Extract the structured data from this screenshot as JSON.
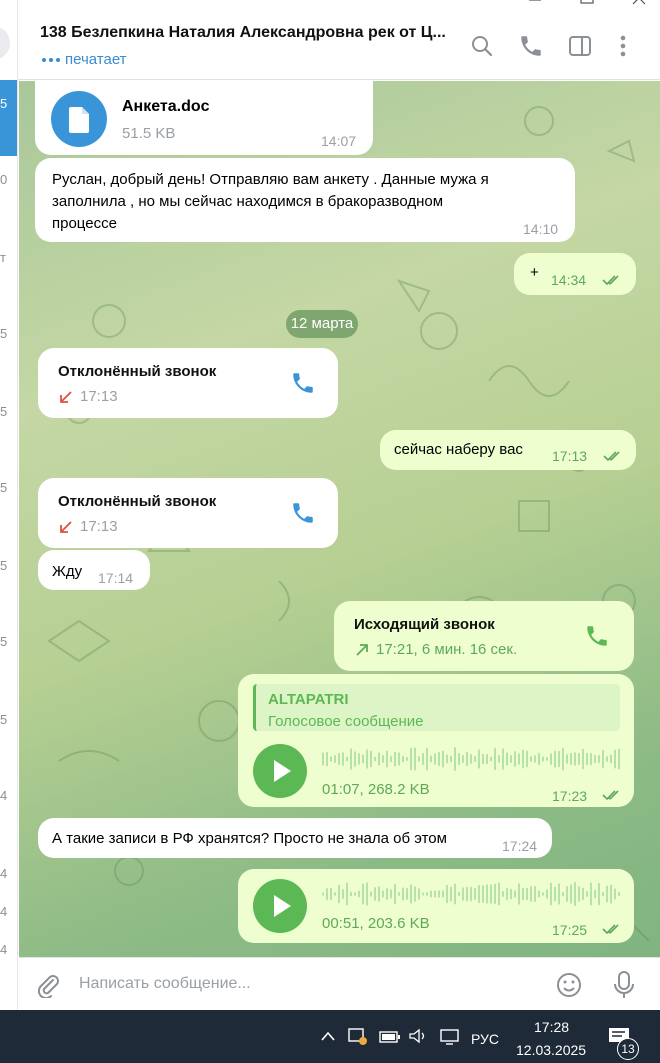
{
  "window": {
    "controls": [
      "minimize",
      "maximize",
      "close"
    ]
  },
  "chat_list_sliver": {
    "cut_texts": [
      "5",
      "0",
      "т",
      "5",
      "5",
      "5",
      "5",
      "5",
      "5",
      "4",
      "4",
      "4",
      "4"
    ]
  },
  "header": {
    "title": "138 Безлепкина Наталия Александровна рек от Ц...",
    "status": "печатает",
    "icons": [
      "search-icon",
      "phone-icon",
      "sidebar-toggle-icon",
      "more-vertical-icon"
    ]
  },
  "messages": {
    "file": {
      "name": "Анкета.doc",
      "size": "51.5 KB",
      "time": "14:07"
    },
    "m1": {
      "line1": "Руслан, добрый день! Отправляю вам анкету . Данные мужа я",
      "line2": "заполнила , но мы сейчас находимся в бракоразводном",
      "line3": "процессе",
      "time": "14:10"
    },
    "m2": {
      "text": "+",
      "time": "14:34"
    },
    "date_chip": "12 марта",
    "call1": {
      "title": "Отклонённый звонок",
      "time": "17:13"
    },
    "m3": {
      "text": "сейчас наберу вас",
      "time": "17:13"
    },
    "call2": {
      "title": "Отклонённый звонок",
      "time": "17:13"
    },
    "m4": {
      "text": "Жду",
      "time": "17:14"
    },
    "call3": {
      "title": "Исходящий звонок",
      "meta": "17:21, 6 мин. 16 сек."
    },
    "voice1": {
      "reply_name": "ALTAPATRI",
      "reply_text": "Голосовое сообщение",
      "meta": "01:07, 268.2 KB",
      "time": "17:23"
    },
    "m5": {
      "text": "А такие записи в РФ хранятся? Просто не знала об этом",
      "time": "17:24"
    },
    "voice2": {
      "meta": "00:51, 203.6 KB",
      "time": "17:25"
    }
  },
  "composer": {
    "placeholder": "Написать сообщение...",
    "value": ""
  },
  "taskbar": {
    "language": "РУС",
    "time": "17:28",
    "date": "12.03.2025",
    "notifications": "13"
  },
  "colors": {
    "accent": "#3a8dd0",
    "out_bubble": "#eefecf",
    "out_meta": "#5fa85a",
    "play": "#5cb854",
    "taskbar": "#1f2a38"
  }
}
